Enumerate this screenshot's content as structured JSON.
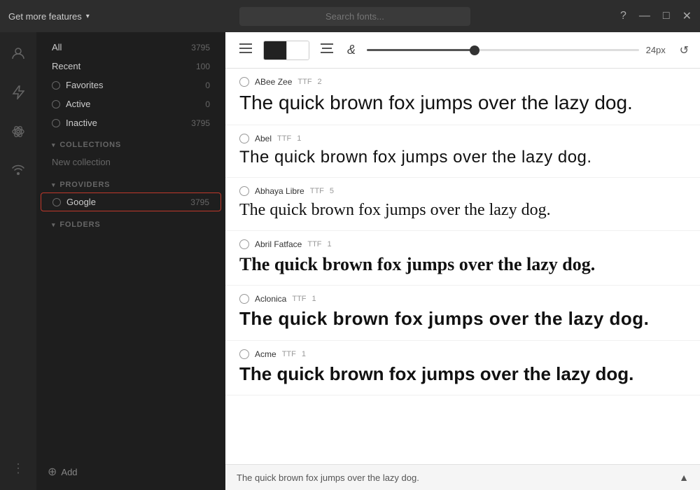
{
  "titlebar": {
    "get_more_features": "Get more features",
    "chevron": "▾",
    "search_placeholder": "Search fonts...",
    "help_icon": "?",
    "minimize_icon": "—",
    "maximize_icon": "□",
    "close_icon": "✕"
  },
  "sidebar_icons": [
    {
      "name": "person-icon",
      "glyph": "○"
    },
    {
      "name": "lightning-icon",
      "glyph": "⚡"
    },
    {
      "name": "atom-icon",
      "glyph": "✦"
    },
    {
      "name": "radio-icon",
      "glyph": "◎"
    }
  ],
  "left_panel": {
    "nav_items": [
      {
        "label": "All",
        "count": "3795",
        "type": "plain"
      },
      {
        "label": "Recent",
        "count": "100",
        "type": "plain"
      },
      {
        "label": "Favorites",
        "count": "0",
        "type": "radio"
      },
      {
        "label": "Active",
        "count": "0",
        "type": "radio"
      },
      {
        "label": "Inactive",
        "count": "3795",
        "type": "radio"
      }
    ],
    "collections_header": "COLLECTIONS",
    "new_collection": "New collection",
    "providers_header": "PROVIDERS",
    "providers": [
      {
        "label": "Google",
        "count": "3795"
      }
    ],
    "folders_header": "FOLDERS",
    "add_label": "Add"
  },
  "toolbar": {
    "size_label": "24px",
    "sample_text": "The quick brown fox jumps over the lazy dog."
  },
  "fonts": [
    {
      "name": "ABee Zee",
      "format": "TTF",
      "variants": "2",
      "preview": "The quick brown fox jumps over the lazy dog.",
      "preview_style": "normal",
      "preview_size": "28px",
      "preview_weight": "400"
    },
    {
      "name": "Abel",
      "format": "TTF",
      "variants": "1",
      "preview": "The quick brown fox jumps over the lazy dog.",
      "preview_style": "normal",
      "preview_size": "24px",
      "preview_weight": "400"
    },
    {
      "name": "Abhaya Libre",
      "format": "TTF",
      "variants": "5",
      "preview": "The quick brown fox jumps over the lazy dog.",
      "preview_style": "normal",
      "preview_size": "24px",
      "preview_weight": "400"
    },
    {
      "name": "Abril Fatface",
      "format": "TTF",
      "variants": "1",
      "preview": "The quick brown fox jumps over the lazy dog.",
      "preview_style": "normal",
      "preview_size": "26px",
      "preview_weight": "900"
    },
    {
      "name": "Aclonica",
      "format": "TTF",
      "variants": "1",
      "preview": "The quick brown fox jumps over the lazy dog.",
      "preview_style": "normal",
      "preview_size": "26px",
      "preview_weight": "700"
    },
    {
      "name": "Acme",
      "format": "TTF",
      "variants": "1",
      "preview": "The quick brown fox jumps over the lazy dog.",
      "preview_style": "normal",
      "preview_size": "26px",
      "preview_weight": "700"
    }
  ],
  "bottom_bar": {
    "text": "The quick brown fox jumps over the lazy dog.",
    "arrow": "▲"
  }
}
